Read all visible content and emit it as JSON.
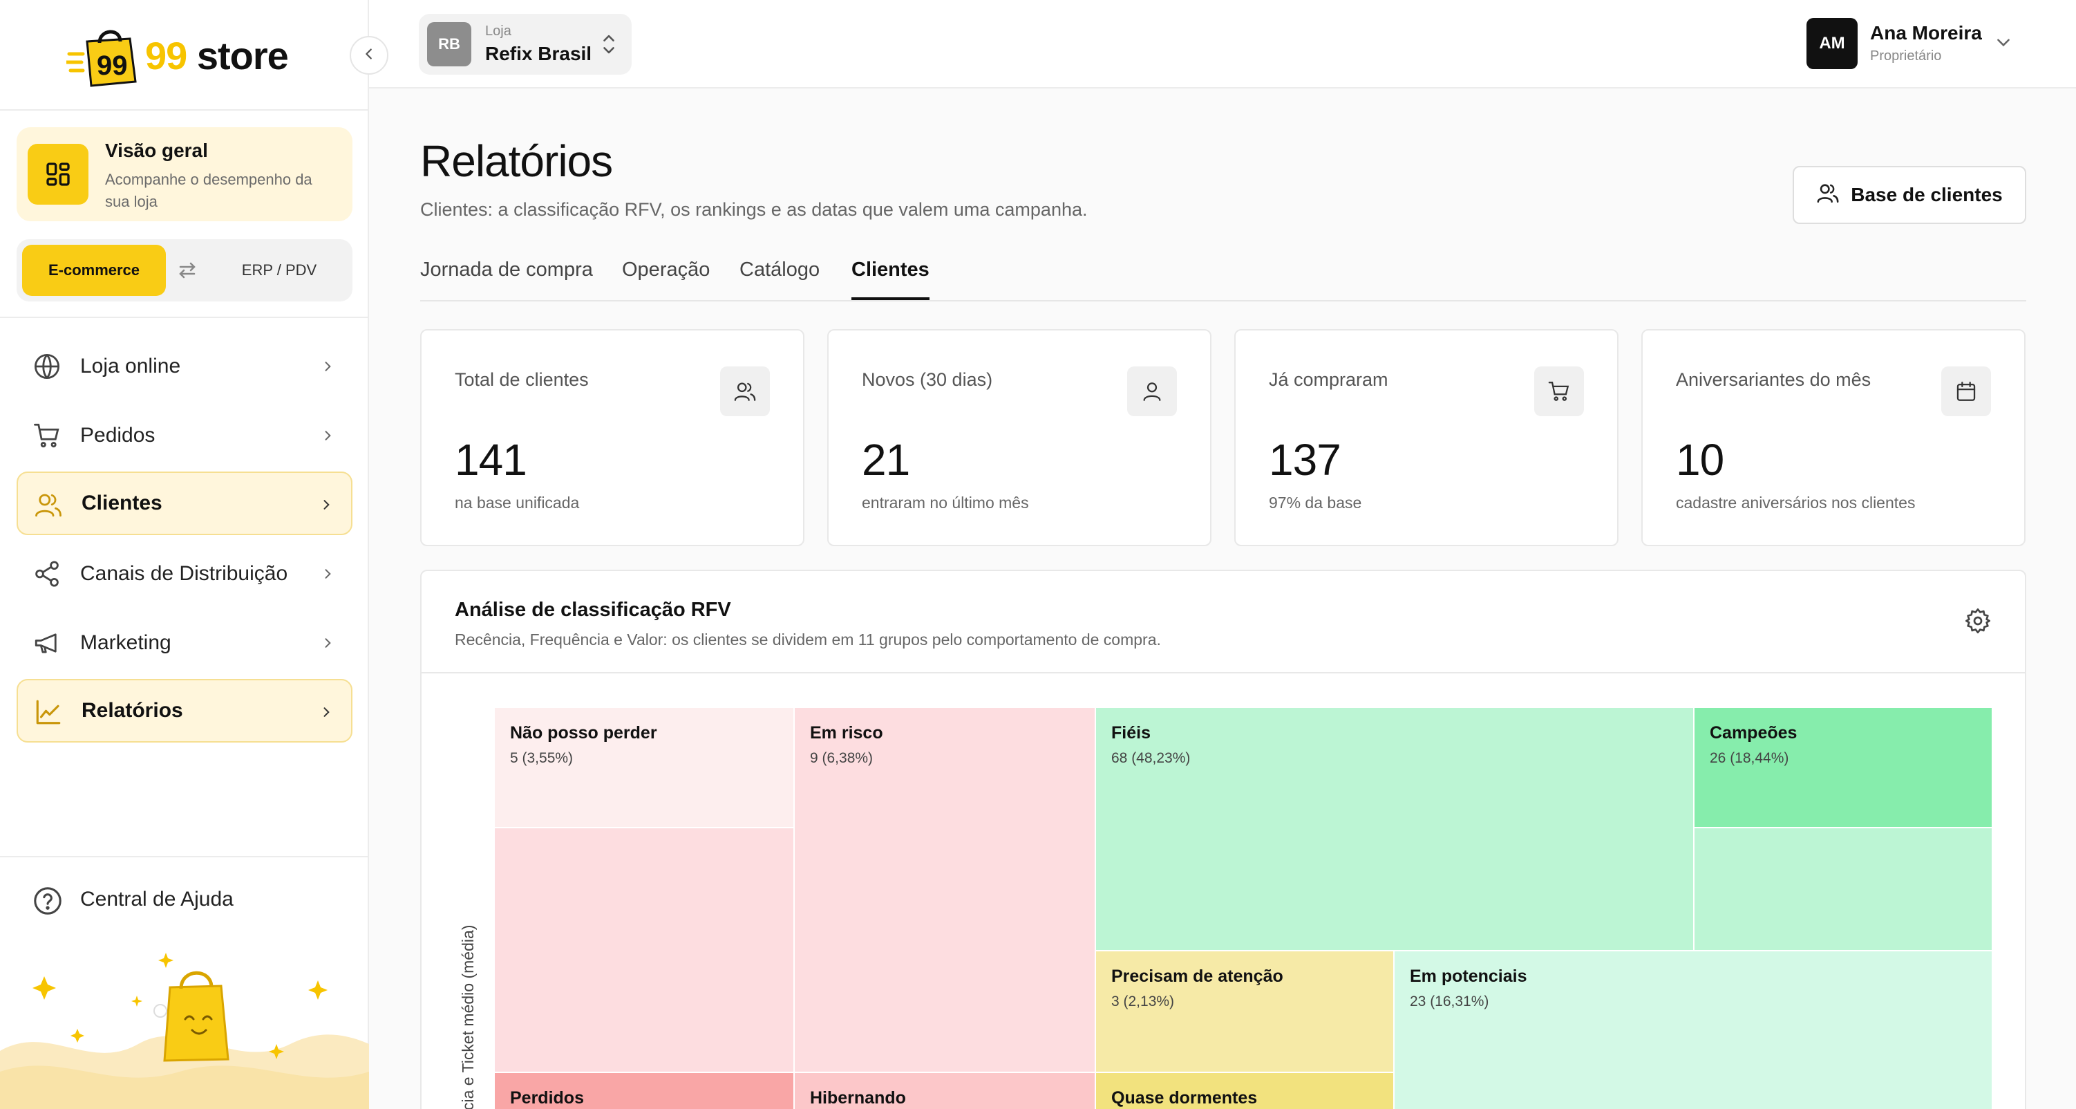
{
  "brand": {
    "logo_text": "99 store",
    "logo_number": "99"
  },
  "sidebar": {
    "overview": {
      "title": "Visão geral",
      "subtitle": "Acompanhe o desempenho da sua loja"
    },
    "mode": {
      "active": "E-commerce",
      "other": "ERP / PDV"
    },
    "items": [
      {
        "label": "Loja online",
        "icon": "globe-icon",
        "active": false
      },
      {
        "label": "Pedidos",
        "icon": "cart-icon",
        "active": false
      },
      {
        "label": "Clientes",
        "icon": "users-icon",
        "active": true
      },
      {
        "label": "Canais de Distribuição",
        "icon": "share-icon",
        "active": false
      },
      {
        "label": "Marketing",
        "icon": "megaphone-icon",
        "active": false
      },
      {
        "label": "Relatórios",
        "icon": "chart-line-icon",
        "active": true
      }
    ],
    "help": {
      "label": "Central de Ajuda",
      "icon": "help-circle-icon"
    }
  },
  "topbar": {
    "store": {
      "initials": "RB",
      "label": "Loja",
      "name": "Refix Brasil"
    },
    "user": {
      "initials": "AM",
      "name": "Ana Moreira",
      "role": "Proprietário"
    }
  },
  "page": {
    "title": "Relatórios",
    "subtitle": "Clientes: a classificação RFV, os rankings e as datas que valem uma campanha.",
    "action_button": "Base de clientes",
    "tabs": [
      {
        "label": "Jornada de compra",
        "active": false
      },
      {
        "label": "Operação",
        "active": false
      },
      {
        "label": "Catálogo",
        "active": false
      },
      {
        "label": "Clientes",
        "active": true
      }
    ]
  },
  "kpis": [
    {
      "label": "Total de clientes",
      "value": "141",
      "note": "na base unificada",
      "icon": "users-icon"
    },
    {
      "label": "Novos (30 dias)",
      "value": "21",
      "note": "entraram no último mês",
      "icon": "user-icon"
    },
    {
      "label": "Já compraram",
      "value": "137",
      "note": "97% da base",
      "icon": "cart-icon"
    },
    {
      "label": "Aniversariantes do mês",
      "value": "10",
      "note": "cadastre aniversários nos clientes",
      "icon": "calendar-icon"
    }
  ],
  "rfv": {
    "title": "Análise de classificação RFV",
    "subtitle": "Recência, Frequência e Valor: os clientes se dividem em 11 grupos pelo comportamento de compra.",
    "y_axis_label": "cia e Ticket médio (média)",
    "groups": [
      {
        "name": "Não posso perder",
        "value": "5 (3,55%)",
        "color": "#fdeeee"
      },
      {
        "name": "Em risco",
        "value": "9 (6,38%)",
        "color": "#fddde0"
      },
      {
        "name": "Fiéis",
        "value": "68 (48,23%)",
        "color": "#bcf5d4"
      },
      {
        "name": "Campeões",
        "value": "26 (18,44%)",
        "color": "#86edac"
      },
      {
        "name": "Precisam de atenção",
        "value": "3 (2,13%)",
        "color": "#f6eaa7"
      },
      {
        "name": "Em potenciais",
        "value": "23 (16,31%)",
        "color": "#d3f9e6"
      },
      {
        "name": "Perdidos",
        "value": "",
        "color": "#f9a6a6"
      },
      {
        "name": "Hibernando",
        "value": "",
        "color": "#fcc7c9"
      },
      {
        "name": "Quase dormentes",
        "value": "",
        "color": "#f2e27e"
      }
    ]
  }
}
